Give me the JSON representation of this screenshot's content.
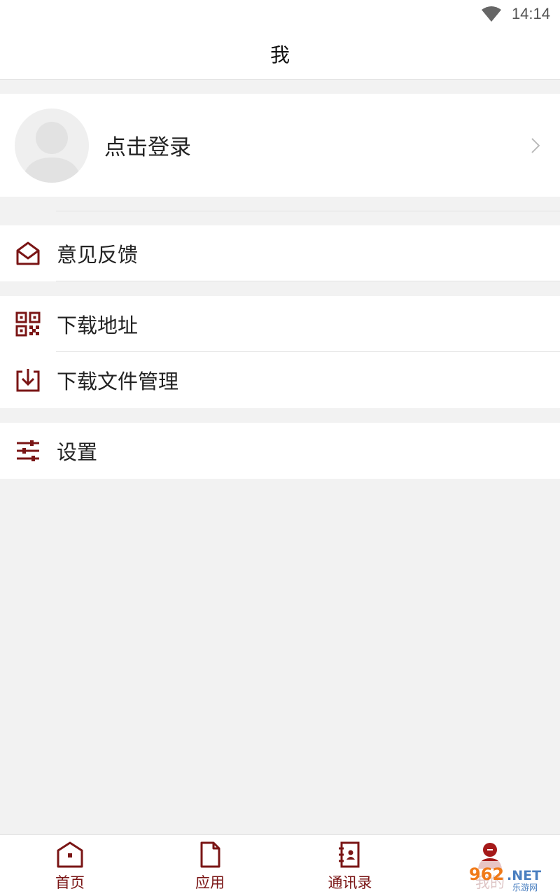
{
  "status_bar": {
    "time": "14:14",
    "wifi_icon": "wifi-icon"
  },
  "header": {
    "title": "我"
  },
  "profile": {
    "login_text": "点击登录",
    "avatar_icon": "avatar-icon",
    "chevron_icon": "chevron-right-icon"
  },
  "menu": {
    "feedback": {
      "label": "意见反馈",
      "icon": "mail-icon"
    },
    "download_address": {
      "label": "下载地址",
      "icon": "qr-code-icon"
    },
    "download_manage": {
      "label": "下载文件管理",
      "icon": "download-icon"
    },
    "settings": {
      "label": "设置",
      "icon": "sliders-icon"
    }
  },
  "tabs": [
    {
      "label": "首页",
      "icon": "home-icon"
    },
    {
      "label": "应用",
      "icon": "document-icon"
    },
    {
      "label": "通讯录",
      "icon": "contacts-icon"
    },
    {
      "label": "我的",
      "icon": "user-icon"
    }
  ],
  "watermark": {
    "text": "962.NET",
    "subtext": "乐游网"
  },
  "colors": {
    "accent": "#7a1515",
    "background": "#f2f2f2",
    "surface": "#ffffff"
  }
}
